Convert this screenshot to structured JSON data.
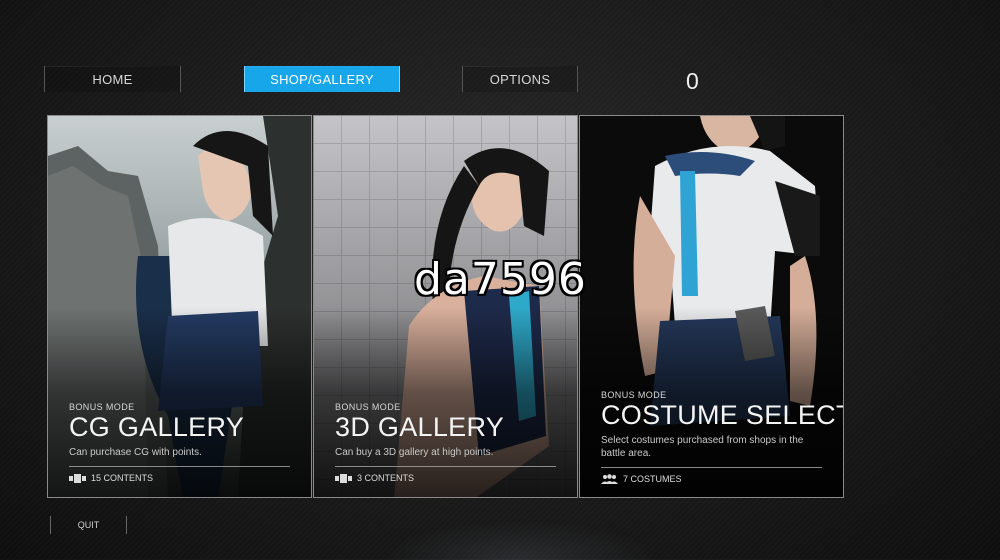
{
  "nav": {
    "home_label": "HOME",
    "shop_label": "SHOP/GALLERY",
    "options_label": "OPTIONS",
    "points": "0"
  },
  "cards": [
    {
      "kicker": "BONUS MODE",
      "title": "CG GALLERY",
      "description": "Can purchase CG with points.",
      "count": "15 CONTENTS",
      "icon": "contents-icon"
    },
    {
      "kicker": "BONUS MODE",
      "title": "3D GALLERY",
      "description": "Can buy a 3D gallery at high points.",
      "count": "3 CONTENTS",
      "icon": "contents-icon"
    },
    {
      "kicker": "BONUS MODE",
      "title": "COSTUME SELECT",
      "description": "Select costumes purchased from shops in the battle area.",
      "count": "7 COSTUMES",
      "icon": "people-icon"
    }
  ],
  "footer": {
    "quit_label": "QUIT"
  },
  "watermark": "da7596",
  "colors": {
    "accent": "#18a6ea",
    "background": "#1a1a1a"
  }
}
